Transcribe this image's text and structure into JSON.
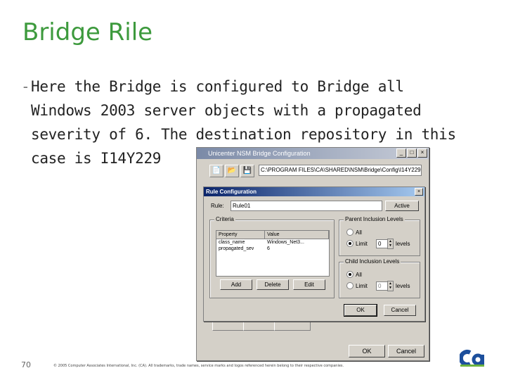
{
  "slide": {
    "title": "Bridge Rile",
    "bullet_lines": [
      "Here the Bridge is configured to Bridge all",
      "Windows 2003 server objects with a propagated",
      "severity of 6. The destination repository in this",
      "case is I14Y229"
    ],
    "page_number": "70",
    "copyright": "© 2005 Computer Associates International, Inc. (CA). All trademarks, trade names, service marks and logos referenced herein belong to their respective companies."
  },
  "outer_dialog": {
    "title": "Unicenter NSM Bridge Configuration",
    "path_value": "C:\\PROGRAM FILES\\CA\\SHARED\\NSM\\Bridge\\Config\\I14Y229.bnc",
    "ok_label": "OK",
    "cancel_label": "Cancel"
  },
  "rule_dialog": {
    "title": "Rule Configuration",
    "rule_label": "Rule:",
    "rule_value": "Rule01",
    "active_label": "Active",
    "criteria": {
      "label": "Criteria",
      "columns": [
        "Property",
        "Value"
      ],
      "rows": [
        {
          "property": "class_name",
          "value": "Windows_Net3..."
        },
        {
          "property": "propagated_sev",
          "value": "6"
        }
      ],
      "add_label": "Add",
      "delete_label": "Delete",
      "edit_label": "Edit"
    },
    "parent_levels": {
      "label": "Parent Inclusion Levels",
      "all_label": "All",
      "limit_label": "Limit",
      "selected": "Limit",
      "limit_value": "0",
      "levels_label": "levels"
    },
    "child_levels": {
      "label": "Child Inclusion Levels",
      "all_label": "All",
      "limit_label": "Limit",
      "selected": "All",
      "limit_value": "0",
      "levels_label": "levels"
    },
    "ok_label": "OK",
    "cancel_label": "Cancel"
  },
  "colors": {
    "title_green": "#3d9a3d",
    "ca_blue": "#1c4f9c",
    "ca_green": "#6cb33f"
  }
}
